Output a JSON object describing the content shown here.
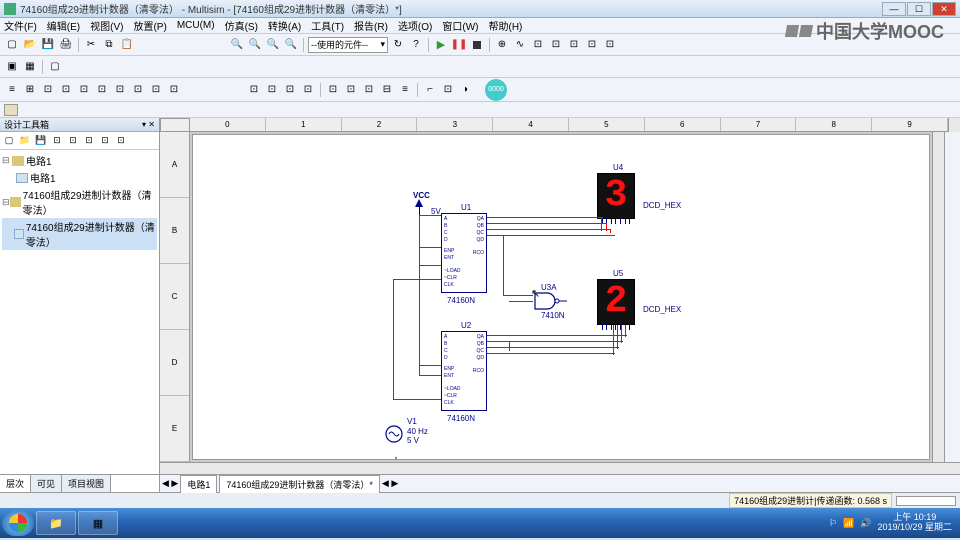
{
  "window": {
    "title": "74160组成29进制计数器（清零法） - Multisim - [74160组成29进制计数器（清零法）*]",
    "min": "—",
    "max": "☐",
    "close": "✕"
  },
  "menu": {
    "file": "文件(F)",
    "edit": "编辑(E)",
    "view": "视图(V)",
    "insert": "放置(P)",
    "mcu": "MCU(M)",
    "simulate": "仿真(S)",
    "transfer": "转换(A)",
    "tools": "工具(T)",
    "reports": "报告(R)",
    "options": "选项(O)",
    "window": "窗口(W)",
    "help": "帮助(H)"
  },
  "toolbar": {
    "component_dropdown": "--使用的元件--",
    "orb": "0000"
  },
  "sidebar": {
    "title": "设计工具箱",
    "items": [
      {
        "label": "电路1",
        "icon": "folder",
        "level": 0
      },
      {
        "label": "电路1",
        "icon": "file",
        "level": 1
      },
      {
        "label": "74160组成29进制计数器（清零法）",
        "icon": "folder",
        "level": 0
      },
      {
        "label": "74160组成29进制计数器（清零法）",
        "icon": "file",
        "level": 1,
        "selected": true
      }
    ],
    "tabs": {
      "hierarchy": "层次",
      "visible": "可见",
      "project": "项目视图"
    }
  },
  "ruler": {
    "h": [
      "0",
      "1",
      "2",
      "3",
      "4",
      "5",
      "6",
      "7",
      "8",
      "9"
    ],
    "v": [
      "A",
      "B",
      "C",
      "D",
      "E"
    ]
  },
  "circuit": {
    "vcc": "VCC",
    "vcc_val": "5V",
    "u1": {
      "ref": "U1",
      "part": "74160N"
    },
    "u2": {
      "ref": "U2",
      "part": "74160N"
    },
    "u3": {
      "ref": "U3A",
      "part": "7410N"
    },
    "u4": {
      "ref": "U4",
      "type": "DCD_HEX",
      "digit": "3"
    },
    "u5": {
      "ref": "U5",
      "type": "DCD_HEX",
      "digit": "2"
    },
    "v1": {
      "ref": "V1",
      "freq": "40 Hz",
      "volt": "5 V"
    },
    "pins": {
      "a": "A",
      "b": "B",
      "c": "C",
      "d": "D",
      "qa": "QA",
      "qb": "QB",
      "qc": "QC",
      "qd": "QD",
      "enp": "ENP",
      "ent": "ENT",
      "rco": "RCO",
      "load": "~LOAD",
      "clr": "~CLR",
      "clk": "CLK"
    }
  },
  "canvas_tabs": {
    "tab1": "电路1",
    "tab2": "74160组成29进制计数器（清零法）*"
  },
  "status": {
    "right": "74160组成29进制计|传递函数: 0.568 s"
  },
  "watermark": {
    "text": "中国大学MOOC"
  },
  "taskbar": {
    "time": "上午 10:19",
    "date": "2019/10/29 星期二"
  }
}
